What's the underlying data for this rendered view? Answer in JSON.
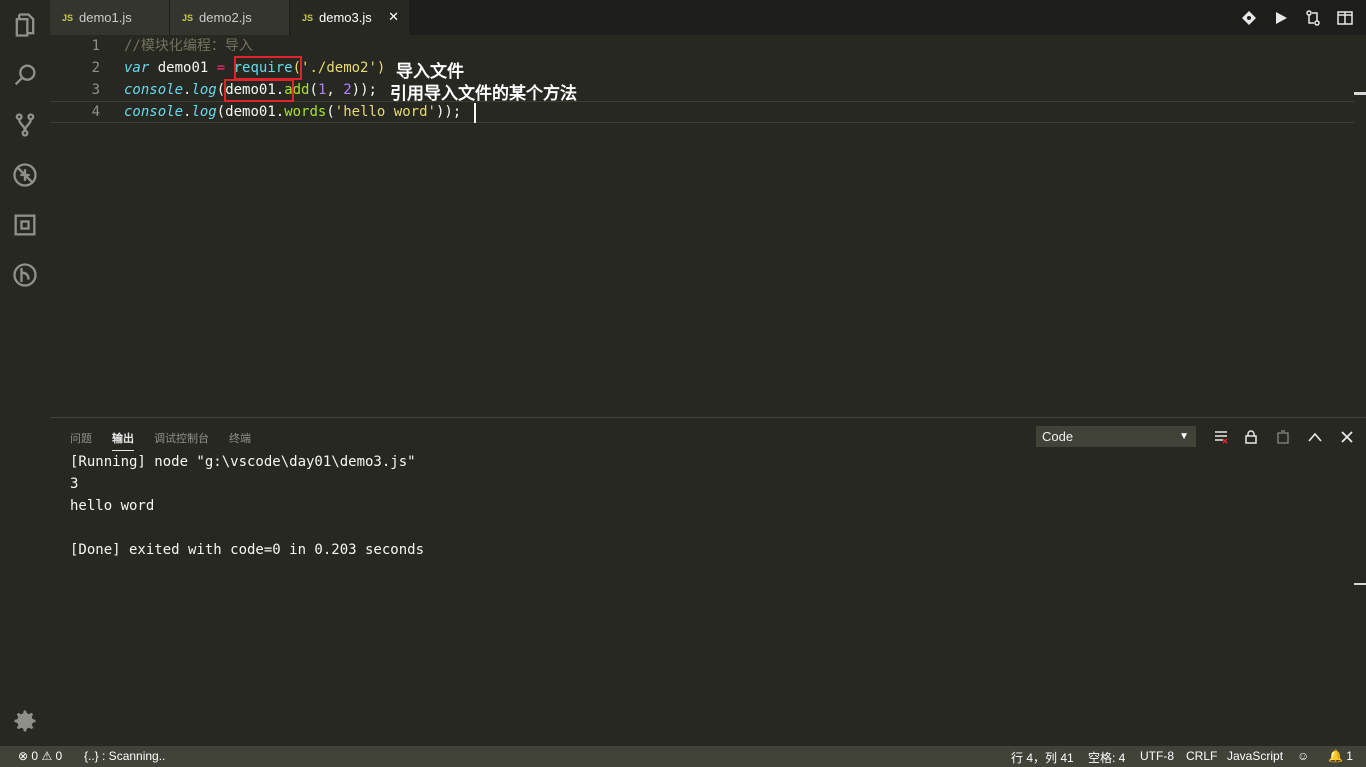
{
  "tabs": [
    {
      "badge": "JS",
      "label": "demo1.js"
    },
    {
      "badge": "JS",
      "label": "demo2.js"
    },
    {
      "badge": "JS",
      "label": "demo3.js",
      "close": "✕"
    }
  ],
  "editor": {
    "line_numbers": [
      "1",
      "2",
      "3",
      "4"
    ],
    "line1": {
      "comment": "//模块化编程：导入"
    },
    "line2": {
      "var": "var",
      "name": " demo01 ",
      "eq": "=",
      "sp": " ",
      "require": "require",
      "args": "('./demo2')"
    },
    "line3": {
      "console": "console",
      "dot": ".",
      "log": "log",
      "open": "(",
      "obj": "demo01.",
      "method": "add",
      "p1": "(",
      "n1": "1",
      "comma": ", ",
      "n2": "2",
      "close": "));"
    },
    "line4": {
      "console": "console",
      "dot": ".",
      "log": "log",
      "open": "(demo01.",
      "method": "words",
      "p1": "(",
      "str": "'hello word'",
      "close": "));"
    },
    "annotations": {
      "import_file": "导入文件",
      "reference_method": "引用导入文件的某个方法"
    }
  },
  "panel": {
    "tabs": [
      "问题",
      "输出",
      "调试控制台",
      "终端"
    ],
    "channel_select": "Code",
    "output_lines": [
      "[Running] node \"g:\\vscode\\day01\\demo3.js\"",
      "3",
      "hello word",
      "",
      "[Done] exited with code=0 in 0.203 seconds"
    ]
  },
  "status": {
    "errors": "0",
    "warnings": "0",
    "scanning": "{..} : Scanning..",
    "position": "行 4，列 41",
    "spaces": "空格: 4",
    "encoding": "UTF-8",
    "eol": "CRLF",
    "language": "JavaScript",
    "notifications": "1"
  },
  "colors": {
    "accent_red": "#e0242b",
    "background": "#272822",
    "status_bar": "#414339"
  }
}
